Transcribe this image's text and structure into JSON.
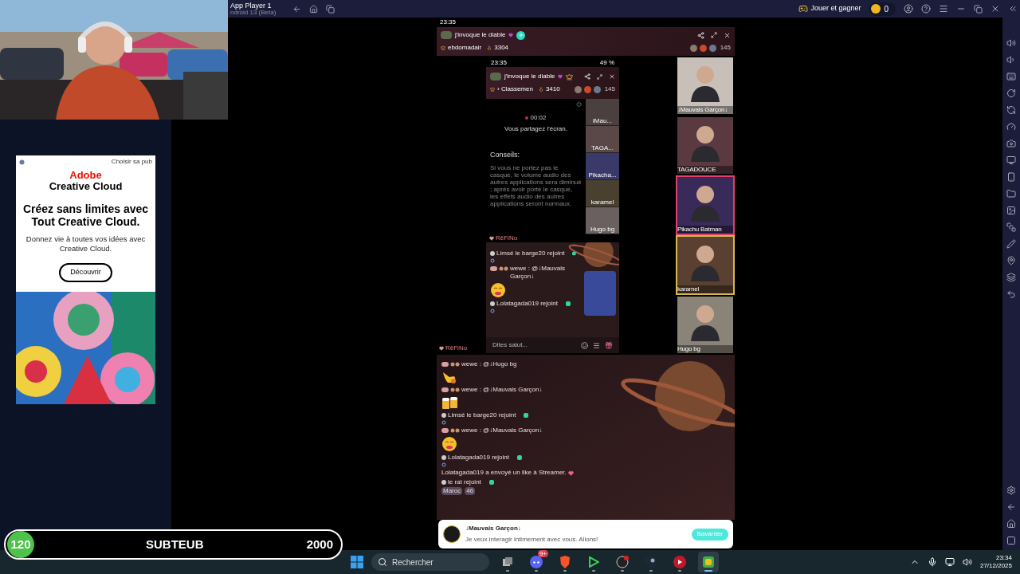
{
  "overlay": {
    "ad": {
      "choice_label": "Choisir sa pub",
      "brand": "Adobe",
      "product": "Creative Cloud",
      "headline": "Créez sans limites avec Tout Creative Cloud.",
      "body": "Donnez vie à toutes vos idées avec Creative Cloud.",
      "button": "Découvrir"
    },
    "goal_bar": {
      "current": "120",
      "label": "SUBTEUB",
      "target": "2000"
    }
  },
  "window": {
    "title": "App Player 1",
    "subtitle": "ndroid 13 (Beta)",
    "promo": "Jouer et gagner",
    "coins": "0"
  },
  "phone": {
    "status_time": "23:35",
    "header": {
      "title": "j'invoque le diable",
      "rank_label": "ebdomadair",
      "score": "3304",
      "viewer_count": "145"
    },
    "host_name": "RēFiNo",
    "shared_screen": {
      "status_time": "23:35",
      "battery": "49 %",
      "header": {
        "title": "j'invoque le diable",
        "rank_label": "› Classemen",
        "score": "3410",
        "viewer_count": "145"
      },
      "timer": "00:02",
      "sharing_text": "Vous partagez l'écran.",
      "tips_title": "Conseils:",
      "tips_text": "Si vous ne portez pas le casque, le volume audio des autres applications sera diminué ; après avoir porté le casque, les effets audio des autres applications seront normaux.",
      "tiles": [
        {
          "name": "iMau..."
        },
        {
          "name": "TAGA..."
        },
        {
          "name": "Pikacha..."
        },
        {
          "name": "karamel"
        },
        {
          "name": "Hugo bg"
        }
      ],
      "host_name": "RēFiNo",
      "chat": [
        {
          "kind": "join",
          "text": "Limsé le barge20 rejoint"
        },
        {
          "kind": "mention",
          "text": "wewe : @↓Mauvais Garçon↓"
        },
        {
          "kind": "kiss"
        },
        {
          "kind": "join",
          "text": "Lolatagada019 rejoint"
        }
      ],
      "input_placeholder": "Dites salut..."
    },
    "guest_tiles": [
      {
        "name": "↓Mauvais Garçon↓"
      },
      {
        "name": "TAGADOUCE"
      },
      {
        "name": "Pikachu Batman",
        "color": "#e0406a"
      },
      {
        "name": "karamel",
        "color": "#d8b84a"
      },
      {
        "name": "Hugo bg"
      }
    ],
    "chat": [
      {
        "kind": "mention",
        "text": "wewe : @↓Hugo bg"
      },
      {
        "kind": "hand"
      },
      {
        "kind": "mention",
        "text": "wewe : @↓Mauvais Garçon↓"
      },
      {
        "kind": "beer"
      },
      {
        "kind": "join",
        "text": "Limsé le barge20 rejoint"
      },
      {
        "kind": "mention",
        "text": "wewe : @↓Mauvais Garçon↓"
      },
      {
        "kind": "kiss"
      },
      {
        "kind": "join",
        "text": "Lolatagada019 rejoint"
      },
      {
        "kind": "like",
        "text": "Lolatagada019 a envoyé un like à Streamer."
      },
      {
        "kind": "join",
        "text": "le rat rejoint",
        "tags": [
          "Maroc",
          "46"
        ]
      }
    ],
    "invite_card": {
      "name": "↓Mauvais Garçon↓",
      "message": "Je veux interagir intimement avec vous. Allons!",
      "button": "Bavarder"
    }
  },
  "taskbar": {
    "search_placeholder": "Rechercher",
    "apps": [
      {
        "selected": false
      },
      {
        "selected": false,
        "badge": "9+"
      },
      {
        "selected": false
      },
      {
        "selected": false
      },
      {
        "selected": false
      },
      {
        "selected": false
      },
      {
        "selected": false
      },
      {
        "selected": true
      }
    ],
    "time": "23:34",
    "date": "27/12/2025"
  }
}
